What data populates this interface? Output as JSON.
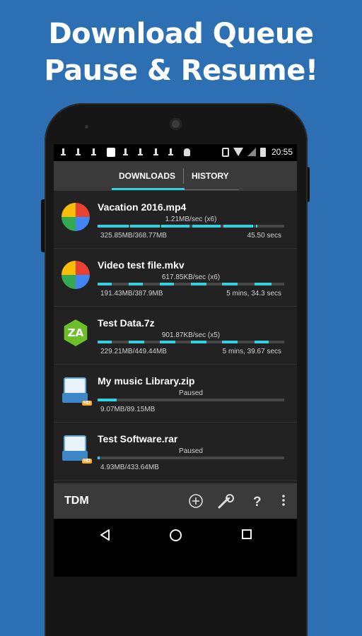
{
  "promo": {
    "line1": "Download Queue",
    "line2": "Pause & Resume!"
  },
  "statusbar": {
    "time": "20:55"
  },
  "tabs": [
    {
      "label": "DOWNLOADS",
      "active": true
    },
    {
      "label": "HISTORY",
      "active": false
    }
  ],
  "downloads": [
    {
      "name": "Vacation 2016.mp4",
      "speed": "1.21MB/sec (x6)",
      "size": "325.85MB/368.77MB",
      "eta": "45.50 secs",
      "icon": "pinwheel-icon"
    },
    {
      "name": "Video test file.mkv",
      "speed": "617.85KB/sec (x6)",
      "size": "191.43MB/387.9MB",
      "eta": "5 mins, 34.3 secs",
      "icon": "pinwheel-icon"
    },
    {
      "name": "Test Data.7z",
      "speed": "901.87KB/sec (x5)",
      "size": "229.21MB/449.44MB",
      "eta": "5 mins, 39.67 secs",
      "icon": "zarchiver-icon"
    },
    {
      "name": "My music Library.zip",
      "speed": "Paused",
      "size": "9.07MB/89.15MB",
      "eta": "",
      "icon": "archive-hd-icon"
    },
    {
      "name": "Test Software.rar",
      "speed": "Paused",
      "size": "4.93MB/433.64MB",
      "eta": "",
      "icon": "archive-hd-icon"
    }
  ],
  "bottombar": {
    "title": "TDM",
    "icons": [
      "add-icon",
      "wrench-icon",
      "help-icon",
      "overflow-menu-icon"
    ]
  },
  "colors": {
    "accent": "#35d0e0",
    "background": "#2d6fb3",
    "list_bg": "#222222",
    "toolbar_bg": "#3a3a3a"
  }
}
